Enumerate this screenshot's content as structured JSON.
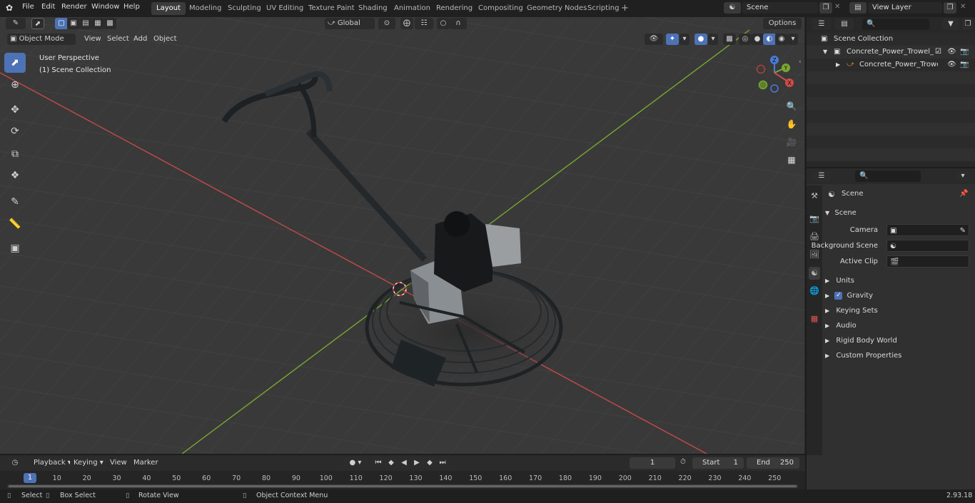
{
  "topbar": {
    "menus": [
      "File",
      "Edit",
      "Render",
      "Window",
      "Help"
    ],
    "workspaces": [
      "Layout",
      "Modeling",
      "Sculpting",
      "UV Editing",
      "Texture Paint",
      "Shading",
      "Animation",
      "Rendering",
      "Compositing",
      "Geometry Nodes",
      "Scripting"
    ],
    "active_workspace": "Layout",
    "scene_name": "Scene",
    "view_layer": "View Layer"
  },
  "viewport": {
    "mode": "Object Mode",
    "menus": [
      "View",
      "Select",
      "Add",
      "Object"
    ],
    "transform_orientation": "Global",
    "options_label": "Options",
    "overlay_line1": "User Perspective",
    "overlay_line2": "(1) Scene Collection",
    "gizmo_axes": {
      "z": "Z",
      "y": "Y",
      "x": "X"
    },
    "colors": {
      "x_axis": "#d14a4a",
      "y_axis": "#7fae2c",
      "selection": "#4d72b5",
      "grid_bg": "#393939"
    }
  },
  "outliner": {
    "root": "Scene Collection",
    "items": [
      {
        "label": "Concrete_Power_Trowel_Grey",
        "indent": 1
      },
      {
        "label": "Concrete_Power_Trowel_",
        "indent": 2
      }
    ]
  },
  "properties": {
    "header_title": "Scene",
    "panel_title": "Scene",
    "fields": [
      {
        "label": "Camera",
        "icon": "camera-icon"
      },
      {
        "label": "Background Scene",
        "icon": "scene-icon"
      },
      {
        "label": "Active Clip",
        "icon": "clip-icon"
      }
    ],
    "sections": [
      "Units",
      "Gravity",
      "Keying Sets",
      "Audio",
      "Rigid Body World",
      "Custom Properties"
    ]
  },
  "timeline": {
    "menus": [
      "Playback",
      "Keying",
      "View",
      "Marker"
    ],
    "current_frame": "1",
    "start_label": "Start",
    "start_value": "1",
    "end_label": "End",
    "end_value": "250",
    "ticks": [
      "1",
      "10",
      "20",
      "30",
      "40",
      "50",
      "60",
      "70",
      "80",
      "90",
      "100",
      "110",
      "120",
      "130",
      "140",
      "150",
      "160",
      "170",
      "180",
      "190",
      "200",
      "210",
      "220",
      "230",
      "240",
      "250"
    ]
  },
  "statusbar": {
    "items": [
      "Select",
      "Box Select",
      "Rotate View",
      "Object Context Menu"
    ],
    "version": "2.93.18"
  }
}
